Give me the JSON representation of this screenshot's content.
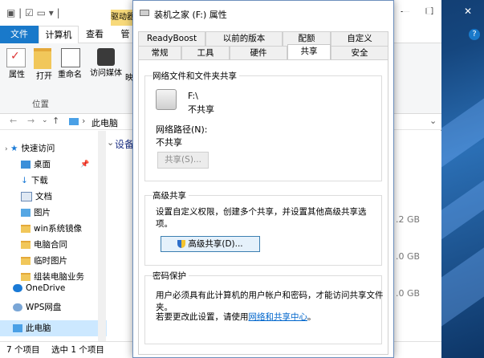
{
  "explorer": {
    "tabs": [
      "文件",
      "计算机",
      "查看",
      "管"
    ],
    "context_tab": "驱动器",
    "ribbon": {
      "properties": "属性",
      "open": "打开",
      "rename": "重命名",
      "access_media": "访问媒体",
      "map": "映",
      "group_label": "位置"
    },
    "address": "此电脑",
    "nav": [
      {
        "label": "快速访问",
        "icon": "star-icon"
      },
      {
        "label": "桌面",
        "icon": "desktop-icon"
      },
      {
        "label": "下载",
        "icon": "download-icon"
      },
      {
        "label": "文档",
        "icon": "document-icon"
      },
      {
        "label": "图片",
        "icon": "picture-icon"
      },
      {
        "label": "win系统镜像",
        "icon": "folder-icon"
      },
      {
        "label": "电脑合同",
        "icon": "folder-icon"
      },
      {
        "label": "临时图片",
        "icon": "folder-icon"
      },
      {
        "label": "组装电脑业务",
        "icon": "folder-icon"
      },
      {
        "label": "OneDrive",
        "icon": "cloud-icon"
      },
      {
        "label": "WPS网盘",
        "icon": "cloud-icon"
      },
      {
        "label": "此电脑",
        "icon": "computer-icon"
      }
    ],
    "content_heading": "设备",
    "sizes": [
      ".2 GB",
      ".0 GB",
      ".0 GB"
    ],
    "status_count": "7 个项目",
    "status_selected": "选中 1 个项目"
  },
  "dialog": {
    "title": "装机之家 (F:) 属性",
    "tabs_row1": [
      "ReadyBoost",
      "以前的版本",
      "配额",
      "自定义"
    ],
    "tabs_row2": [
      "常规",
      "工具",
      "硬件",
      "共享",
      "安全"
    ],
    "active_tab": "共享",
    "network_group": "网络文件和文件夹共享",
    "drive_name": "F:\\",
    "drive_status": "不共享",
    "network_path_label": "网络路径(N):",
    "network_path_value": "不共享",
    "share_button": "共享(S)...",
    "advanced_group": "高级共享",
    "advanced_desc": "设置自定义权限，创建多个共享，并设置其他高级共享选项。",
    "advanced_button": "高级共享(D)...",
    "password_group": "密码保护",
    "password_desc": "用户必须具有此计算机的用户帐户和密码，才能访问共享文件夹。",
    "password_change_prefix": "若要更改此设置，请使用",
    "password_link": "网络和共享中心",
    "password_suffix": "。"
  }
}
